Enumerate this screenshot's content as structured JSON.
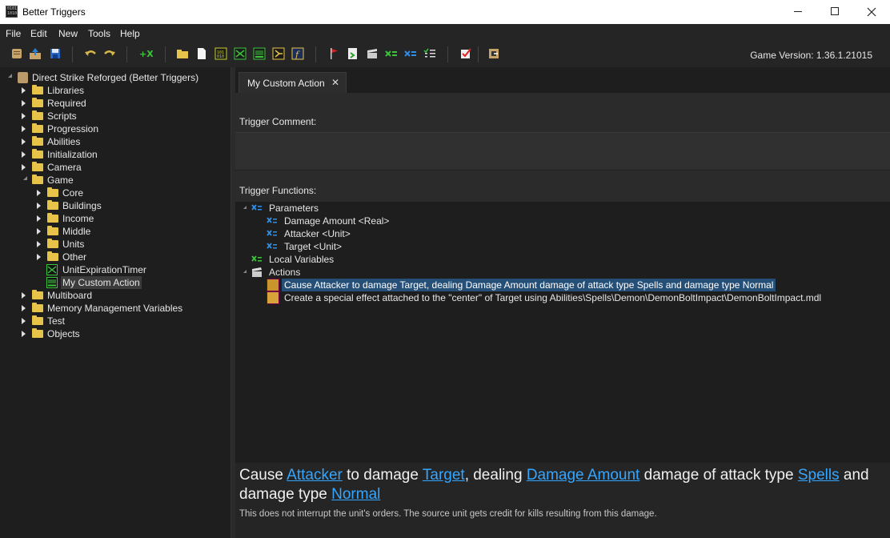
{
  "window": {
    "title": "Better Triggers",
    "controls": [
      "minimize",
      "maximize",
      "close"
    ]
  },
  "menu": [
    "File",
    "Edit",
    "New",
    "Tools",
    "Help"
  ],
  "toolbar": {
    "game_version": "Game Version: 1.36.1.21015",
    "icons": [
      "scroll-icon",
      "export-icon",
      "save-icon",
      "undo-icon",
      "redo-icon",
      "new-variable-icon",
      "new-folder-icon",
      "new-file-icon",
      "new-script-icon",
      "new-trigger-icon",
      "new-action-icon",
      "new-event-icon",
      "new-function-icon",
      "flag-icon",
      "test-map-icon",
      "clapper-icon",
      "local-variable-icon",
      "parameter-icon",
      "list-icon",
      "checklist-icon",
      "door-icon"
    ]
  },
  "tree": {
    "root": "Direct Strike Reforged (Better Triggers)",
    "items": [
      {
        "label": "Libraries",
        "level": 1,
        "state": "closed",
        "kind": "folder"
      },
      {
        "label": "Required",
        "level": 1,
        "state": "closed",
        "kind": "folder"
      },
      {
        "label": "Scripts",
        "level": 1,
        "state": "closed",
        "kind": "folder"
      },
      {
        "label": "Progression",
        "level": 1,
        "state": "closed",
        "kind": "folder"
      },
      {
        "label": "Abilities",
        "level": 1,
        "state": "closed",
        "kind": "folder"
      },
      {
        "label": "Initialization",
        "level": 1,
        "state": "closed",
        "kind": "folder"
      },
      {
        "label": "Camera",
        "level": 1,
        "state": "closed",
        "kind": "folder"
      },
      {
        "label": "Game",
        "level": 1,
        "state": "open",
        "kind": "folder"
      },
      {
        "label": "Core",
        "level": 2,
        "state": "closed",
        "kind": "folder"
      },
      {
        "label": "Buildings",
        "level": 2,
        "state": "closed",
        "kind": "folder"
      },
      {
        "label": "Income",
        "level": 2,
        "state": "closed",
        "kind": "folder"
      },
      {
        "label": "Middle",
        "level": 2,
        "state": "closed",
        "kind": "folder"
      },
      {
        "label": "Units",
        "level": 2,
        "state": "closed",
        "kind": "folder"
      },
      {
        "label": "Other",
        "level": 2,
        "state": "closed",
        "kind": "folder"
      },
      {
        "label": "UnitExpirationTimer",
        "level": 2,
        "state": "none",
        "kind": "trigger"
      },
      {
        "label": "My Custom Action",
        "level": 2,
        "state": "none",
        "kind": "action",
        "selected": true
      },
      {
        "label": "Multiboard",
        "level": 1,
        "state": "closed",
        "kind": "folder"
      },
      {
        "label": "Memory Management Variables",
        "level": 1,
        "state": "closed",
        "kind": "folder"
      },
      {
        "label": "Test",
        "level": 1,
        "state": "closed",
        "kind": "folder"
      },
      {
        "label": "Objects",
        "level": 1,
        "state": "closed",
        "kind": "folder"
      }
    ]
  },
  "tab": {
    "label": "My Custom Action",
    "close": "✕"
  },
  "trigger_comment_label": "Trigger Comment:",
  "trigger_functions_label": "Trigger Functions:",
  "functions": {
    "parameters_label": "Parameters",
    "parameters": [
      "Damage Amount  <Real>",
      "Attacker  <Unit>",
      "Target  <Unit>"
    ],
    "local_variables_label": "Local Variables",
    "actions_label": "Actions",
    "actions": [
      "Cause Attacker to damage Target, dealing Damage Amount damage of attack type Spells and damage type Normal",
      "Create a special effect attached to the \"center\" of Target using Abilities\\Spells\\Demon\\DemonBoltImpact\\DemonBoltImpact.mdl"
    ]
  },
  "description": {
    "t1": "Cause ",
    "l1": "Attacker",
    "t2": " to damage ",
    "l2": "Target",
    "t3": ", dealing ",
    "l3": "Damage Amount",
    "t4": " damage of attack type ",
    "l4": "Spells",
    "t5": " and damage type ",
    "l5": "Normal",
    "sub": "This does not interrupt the unit's orders.  The source unit gets credit for kills resulting from this damage."
  },
  "colors": {
    "accent_link": "#35a6ff",
    "selection": "#264f78",
    "panel_bg": "#1e1e1e"
  }
}
